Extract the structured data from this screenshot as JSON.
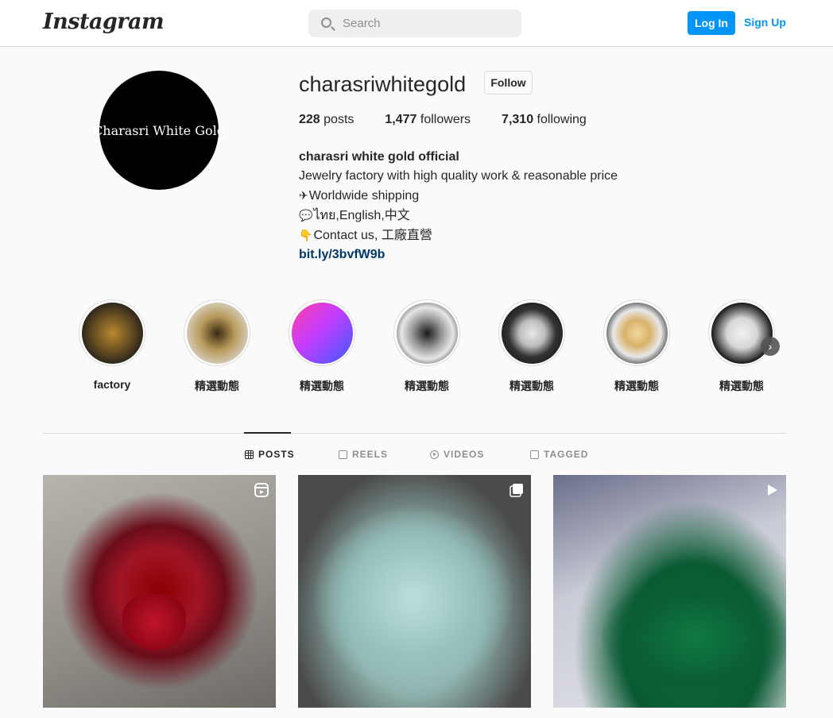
{
  "nav": {
    "logo": "Instagram",
    "search_placeholder": "Search",
    "login_label": "Log In",
    "signup_label": "Sign Up"
  },
  "profile": {
    "avatar_text": "Charasri White Gold",
    "username": "charasriwhitegold",
    "follow_label": "Follow",
    "posts_count": "228",
    "posts_label": "posts",
    "followers_count": "1,477",
    "followers_label": "followers",
    "following_count": "7,310",
    "following_label": "following",
    "bio_name": "charasri white gold official",
    "bio_lines": [
      "Jewelry factory with high quality work & reasonable price",
      "Worldwide shipping",
      "ไทย,English,中文",
      "Contact us, 工廠直營"
    ],
    "bio_link": "bit.ly/3bvfW9b"
  },
  "highlights": [
    {
      "label": "factory"
    },
    {
      "label": "精選動態"
    },
    {
      "label": "精選動態"
    },
    {
      "label": "精選動態"
    },
    {
      "label": "精選動態"
    },
    {
      "label": "精選動態"
    },
    {
      "label": "精選動態"
    }
  ],
  "tabs": [
    {
      "label": "POSTS",
      "icon": "grid-icon",
      "active": true
    },
    {
      "label": "REELS",
      "icon": "reels-icon",
      "active": false
    },
    {
      "label": "VIDEOS",
      "icon": "play-circle-icon",
      "active": false
    },
    {
      "label": "TAGGED",
      "icon": "tagged-icon",
      "active": false
    }
  ],
  "posts": [
    {
      "badge": "reels-icon",
      "subject": "ruby brooch"
    },
    {
      "badge": "carousel-icon",
      "subject": "aquamarine gemstones"
    },
    {
      "badge": "video-icon",
      "subject": "emeralds in bag"
    }
  ],
  "colors": {
    "accent": "#0095f6",
    "link": "#00376b",
    "text": "#262626",
    "muted": "#8e8e8e",
    "border": "#dbdbdb"
  }
}
